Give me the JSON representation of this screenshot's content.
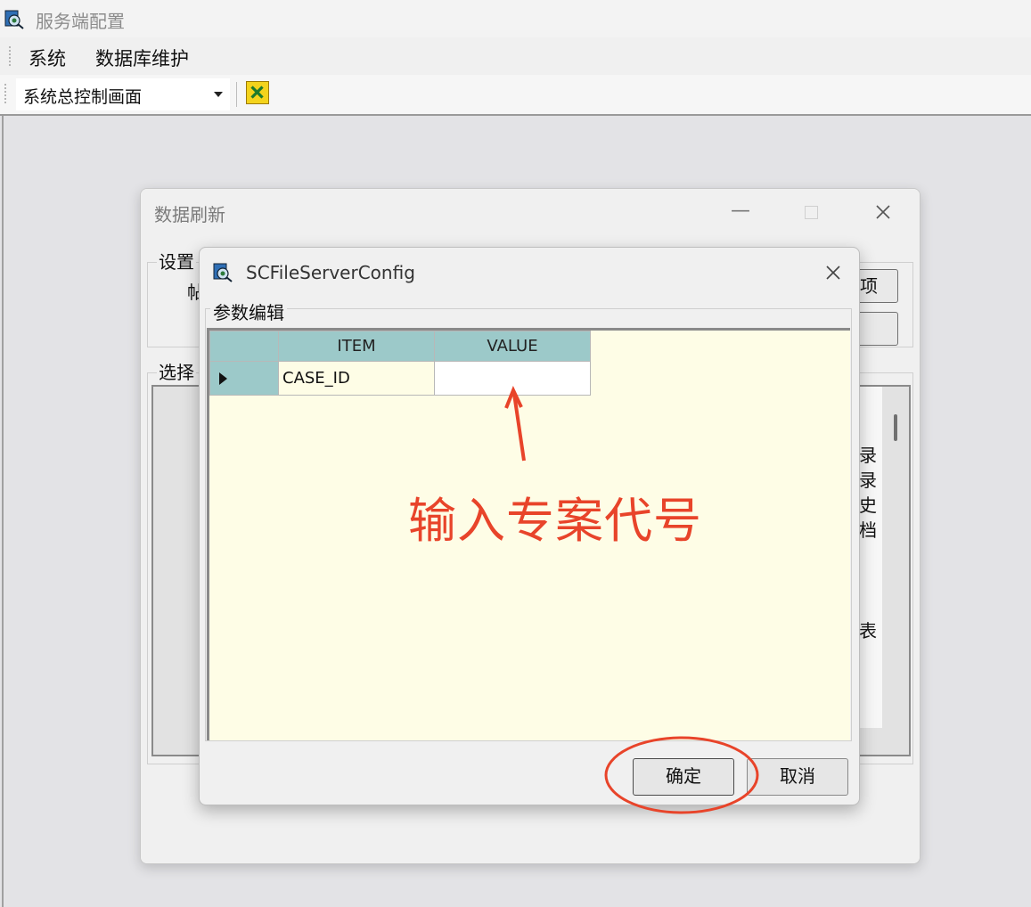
{
  "window": {
    "title": "服务端配置"
  },
  "menu": {
    "items": [
      "系统",
      "数据库维护"
    ]
  },
  "toolbar": {
    "combo_value": "系统总控制画面"
  },
  "bg_dialog": {
    "title": "数据刷新",
    "group_settings": "设置",
    "partial_char": "帖",
    "btn_top_label": "项",
    "group_select": "选择",
    "side_chars": [
      "录",
      "录",
      "史",
      "档",
      "表"
    ]
  },
  "dialog": {
    "title": "SCFileServerConfig",
    "group_label": "参数编辑",
    "grid": {
      "columns": [
        "ITEM",
        "VALUE"
      ],
      "rows": [
        {
          "item": "CASE_ID",
          "value": ""
        }
      ]
    },
    "ok_label": "确定",
    "cancel_label": "取消"
  },
  "annotation": {
    "text": "输入专案代号",
    "color": "#e8442a"
  }
}
